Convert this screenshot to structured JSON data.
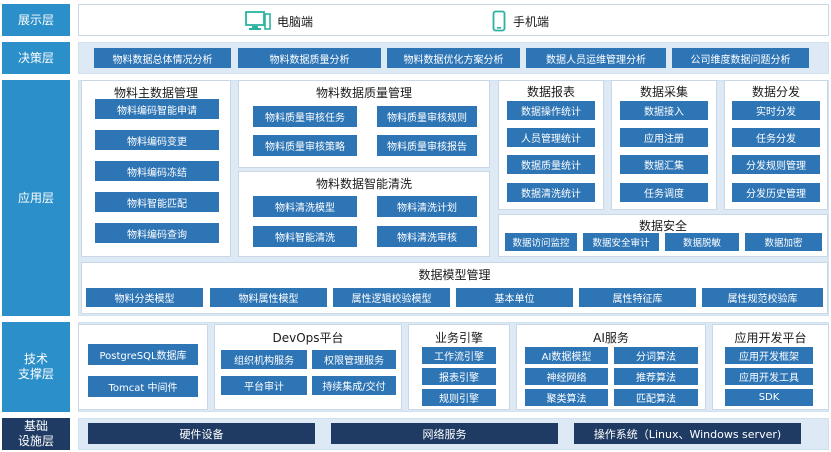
{
  "layers": {
    "display": "展示层",
    "decision": "决策层",
    "application": "应用层",
    "tech": "技术\n支撑层",
    "infra": "基础\n设施层"
  },
  "display": {
    "pc": "电脑端",
    "mobile": "手机端"
  },
  "decision": {
    "items": [
      "物料数据总体情况分析",
      "物料数据质量分析",
      "物料数据优化方案分析",
      "数据人员运维管理分析",
      "公司维度数据问题分析"
    ]
  },
  "app": {
    "master": {
      "title": "物料主数据管理",
      "items": [
        "物料编码智能申请",
        "物料编码变更",
        "物料编码冻结",
        "物料智能匹配",
        "物料编码查询"
      ]
    },
    "quality": {
      "title": "物料数据质量管理",
      "items": [
        "物料质量审核任务",
        "物料质量审核规则",
        "物料质量审核策略",
        "物料质量审核报告"
      ]
    },
    "clean": {
      "title": "物料数据智能清洗",
      "items": [
        "物料清洗模型",
        "物料清洗计划",
        "物料智能清洗",
        "物料清洗审核"
      ]
    },
    "report": {
      "title": "数据报表",
      "items": [
        "数据操作统计",
        "人员管理统计",
        "数据质量统计",
        "数据清洗统计"
      ]
    },
    "collect": {
      "title": "数据采集",
      "items": [
        "数据接入",
        "应用注册",
        "数据汇集",
        "任务调度"
      ]
    },
    "distribute": {
      "title": "数据分发",
      "items": [
        "实时分发",
        "任务分发",
        "分发规则管理",
        "分发历史管理"
      ]
    },
    "security": {
      "title": "数据安全",
      "items": [
        "数据访问监控",
        "数据安全审计",
        "数据脱敏",
        "数据加密"
      ]
    },
    "model": {
      "title": "数据模型管理",
      "items": [
        "物料分类模型",
        "物料属性模型",
        "属性逻辑校验模型",
        "基本单位",
        "属性特征库",
        "属性规范校验库"
      ]
    }
  },
  "tech": {
    "db": {
      "items": [
        "PostgreSQL数据库",
        "Tomcat 中间件"
      ]
    },
    "devops": {
      "title": "DevOps平台",
      "items": [
        "组织机构服务",
        "权限管理服务",
        "平台审计",
        "持续集成/交付"
      ]
    },
    "engine": {
      "title": "业务引擎",
      "items": [
        "工作流引擎",
        "报表引擎",
        "规则引擎"
      ]
    },
    "ai": {
      "title": "AI服务",
      "items": [
        "AI数据模型",
        "分词算法",
        "神经网络",
        "推荐算法",
        "聚类算法",
        "匹配算法"
      ]
    },
    "devplat": {
      "title": "应用开发平台",
      "items": [
        "应用开发框架",
        "应用开发工具",
        "SDK"
      ]
    }
  },
  "infra": {
    "items": [
      "硬件设备",
      "网络服务",
      "操作系统（Linux、Windows server)"
    ]
  },
  "icons": [
    "monitor-icon",
    "phone-icon"
  ],
  "colors": {
    "layer": "#2b8fc9",
    "button": "#2e75b6",
    "dark": "#1f3b63",
    "band": "#ddeaf6"
  }
}
